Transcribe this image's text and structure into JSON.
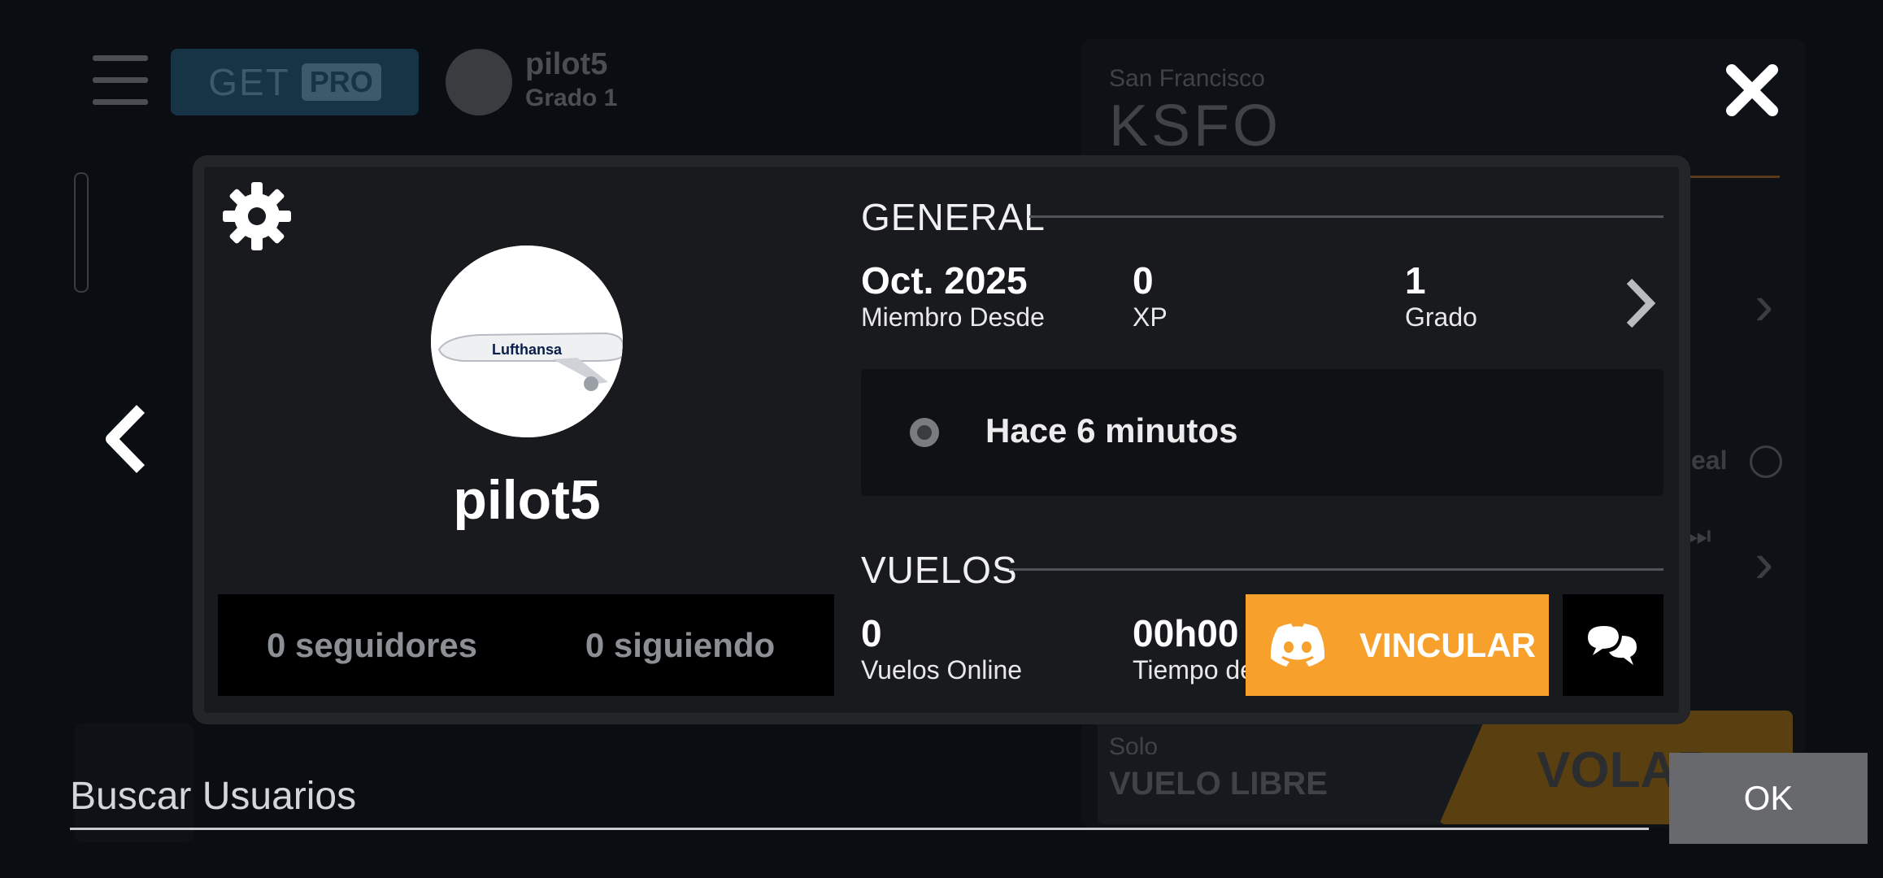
{
  "background": {
    "get_label": "GET",
    "pro_label": "PRO",
    "username": "pilot5",
    "grade": "Grado 1",
    "airport_city": "San Francisco",
    "airport_code": "KSFO",
    "real_label": "eal",
    "solo_label": "Solo",
    "mode_label": "VUELO LIBRE",
    "fly_label": "VOLAR"
  },
  "search": {
    "placeholder": "Buscar Usuarios"
  },
  "ok_label": "OK",
  "profile": {
    "name": "pilot5",
    "followers": "0 seguidores",
    "following": "0 siguiendo",
    "avatar_text": "Lufthansa",
    "general": {
      "title": "GENERAL",
      "stats": [
        {
          "value": "Oct. 2025",
          "label": "Miembro Desde"
        },
        {
          "value": "0",
          "label": "XP"
        },
        {
          "value": "1",
          "label": "Grado"
        }
      ]
    },
    "status": "Hace 6 minutos",
    "flights": {
      "title": "VUELOS",
      "stats": [
        {
          "value": "0",
          "label": "Vuelos Online"
        },
        {
          "value": "00h00",
          "label": "Tiempo de"
        }
      ]
    },
    "link_label": "VINCULAR"
  },
  "colors": {
    "accent_orange": "#f7a12c",
    "modal_bg": "#181a1d",
    "ok_bg": "#67696c"
  }
}
